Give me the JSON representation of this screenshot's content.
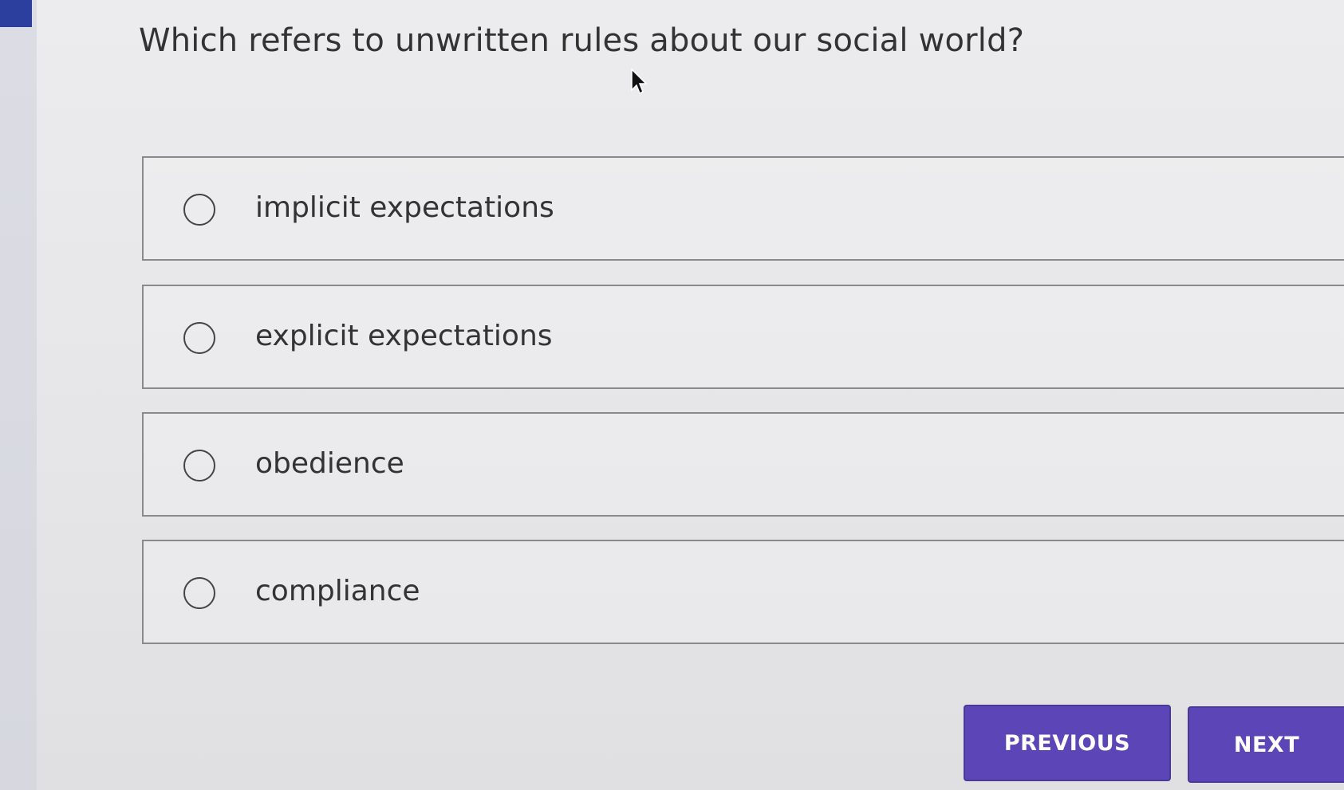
{
  "question": {
    "text": "Which refers to unwritten rules about our social world?"
  },
  "options": [
    {
      "label": "implicit expectations",
      "selected": false
    },
    {
      "label": "explicit expectations",
      "selected": false
    },
    {
      "label": "obedience",
      "selected": false
    },
    {
      "label": "compliance",
      "selected": false
    }
  ],
  "navigation": {
    "previous_label": "PREVIOUS",
    "next_label": "NEXT"
  },
  "colors": {
    "button_background": "#5b45b7",
    "rail_accent": "#2c3e9e",
    "text": "#333333"
  },
  "icons": {
    "cursor": "mouse-pointer-icon",
    "radio": "radio-circle-icon"
  }
}
